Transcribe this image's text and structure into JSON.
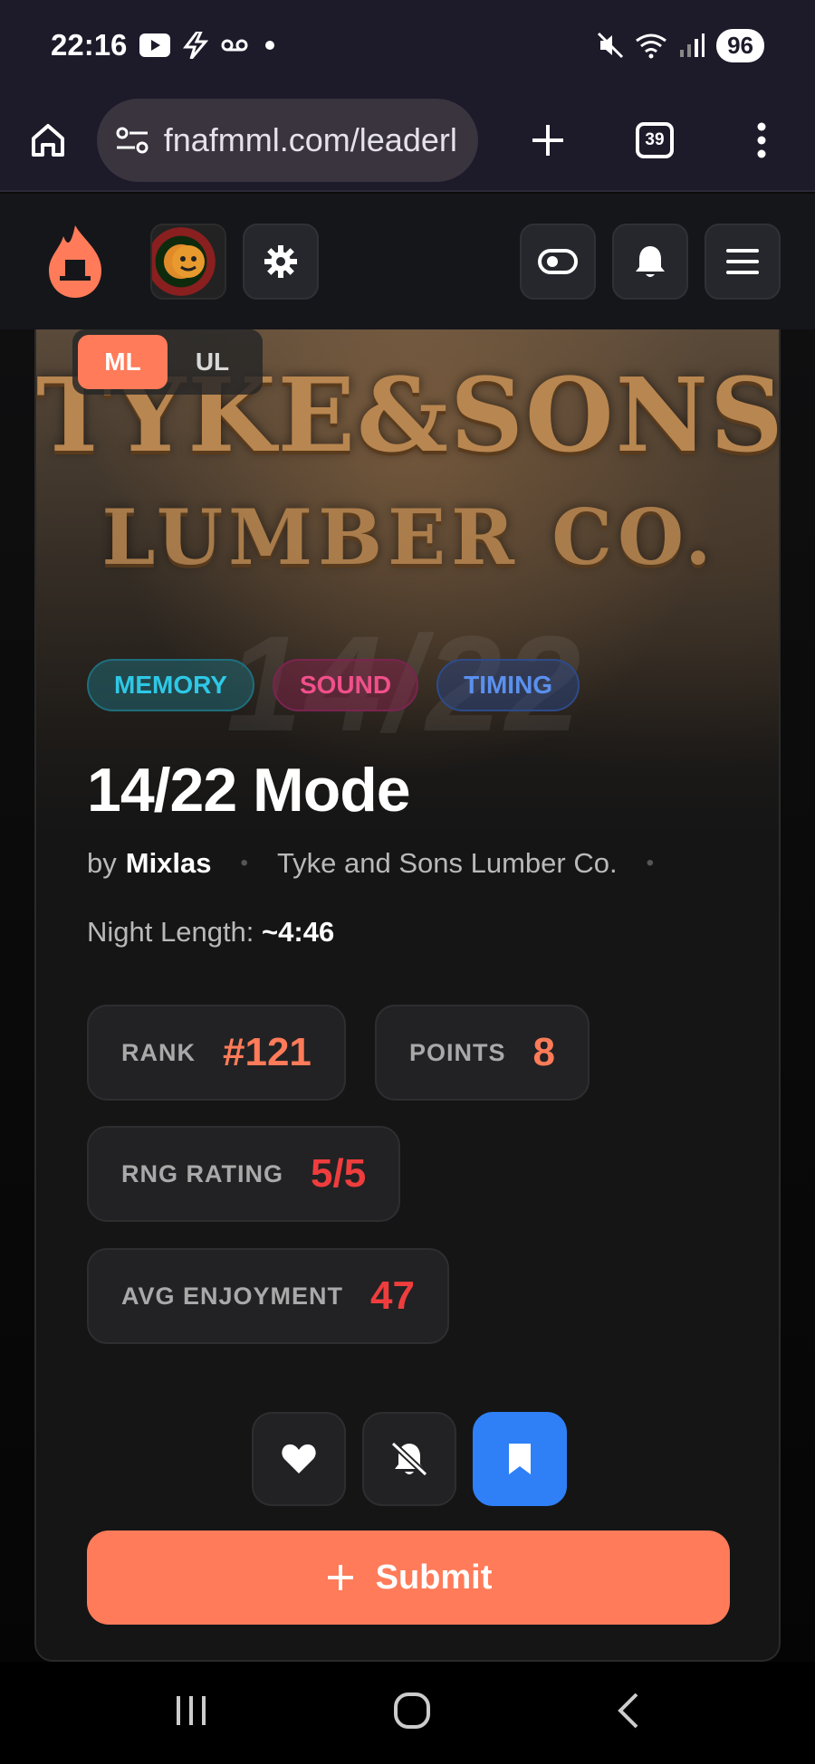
{
  "status_bar": {
    "time": "22:16",
    "battery": "96",
    "icons": [
      "youtube-icon",
      "bolt-icon",
      "voicemail-icon",
      "dot-icon",
      "mute-icon",
      "wifi-icon",
      "signal-icon"
    ]
  },
  "browser": {
    "url": "fnafmml.com/leaderl",
    "tab_count": "39",
    "icons": [
      "home-icon",
      "site-info-icon",
      "plus-icon",
      "tabs-icon",
      "more-icon"
    ]
  },
  "header": {
    "icons": [
      "flame-hat-logo",
      "avatar",
      "gear-icon",
      "toggle-icon",
      "bell-icon",
      "menu-icon"
    ]
  },
  "banner": {
    "title_line1": "TYKE&SONS",
    "title_line2": "LUMBER CO.",
    "watermark": "14/22"
  },
  "segment": {
    "options": [
      "ML",
      "UL"
    ],
    "selected": "ML"
  },
  "tags": [
    "MEMORY",
    "SOUND",
    "TIMING"
  ],
  "mode": {
    "title": "14/22 Mode",
    "by_prefix": "by",
    "author": "Mixlas",
    "location": "Tyke and Sons Lumber Co.",
    "night_length_label": "Night Length:",
    "night_length_value": "~4:46"
  },
  "stats": {
    "rank_label": "RANK",
    "rank_value": "#121",
    "points_label": "POINTS",
    "points_value": "8",
    "rng_label": "RNG RATING",
    "rng_value": "5/5",
    "enjoy_label": "AVG ENJOYMENT",
    "enjoy_value": "47"
  },
  "actions": {
    "icons": [
      "heart-icon",
      "bell-off-icon",
      "bookmark-icon"
    ],
    "submit_label": "Submit"
  },
  "colors": {
    "accent": "#ff7b59",
    "red": "#ef3d3d",
    "blue": "#2f80f7",
    "status_bg": "#1d1b2a"
  }
}
